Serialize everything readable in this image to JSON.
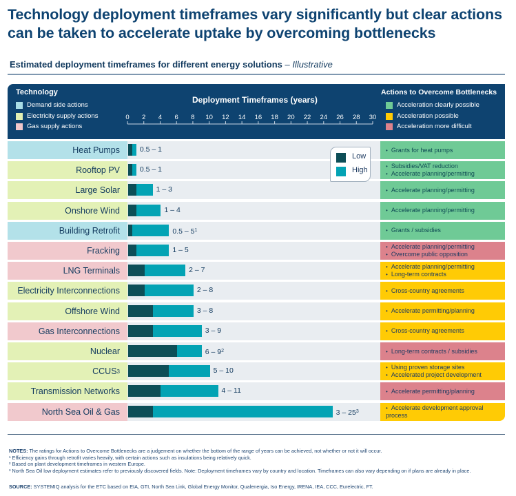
{
  "title": "Technology deployment timeframes vary significantly but clear actions can be taken to accelerate uptake by overcoming bottlenecks",
  "subtitle": "Estimated deployment timeframes for different energy solutions",
  "subtitle_suffix": " – Illustrative",
  "header": {
    "technology_heading": "Technology",
    "technology_legend": [
      {
        "label": "Demand side actions",
        "color": "#a8dde6"
      },
      {
        "label": "Electricity supply actions",
        "color": "#e2f0b3"
      },
      {
        "label": "Gas supply actions",
        "color": "#f0c7cb"
      }
    ],
    "deployment_heading": "Deployment Timeframes (years)",
    "actions_heading": "Actions to Overcome Bottlenecks",
    "actions_legend": [
      {
        "label": "Acceleration clearly possible",
        "color": "#6fca96"
      },
      {
        "label": "Acceleration possible",
        "color": "#ffcb05"
      },
      {
        "label": "Acceleration more difficult",
        "color": "#dc828c"
      }
    ]
  },
  "bar_legend": {
    "low_label": "Low",
    "high_label": "High",
    "low_color": "#0d4e57",
    "high_color": "#03a3b4"
  },
  "chart_data": {
    "type": "bar",
    "orientation": "horizontal-range",
    "title": "Estimated deployment timeframes for different energy solutions – Illustrative",
    "xlabel": "Deployment Timeframes (years)",
    "xlim": [
      0,
      30
    ],
    "xticks": [
      0,
      2,
      4,
      6,
      8,
      10,
      12,
      14,
      16,
      18,
      20,
      22,
      24,
      26,
      28,
      30
    ],
    "legend": [
      "Low",
      "High"
    ],
    "legend_position": "top-right",
    "categories": [
      "Heat Pumps",
      "Rooftop PV",
      "Large Solar",
      "Onshore Wind",
      "Building Retrofit",
      "Fracking",
      "LNG Terminals",
      "Electricity Interconnections",
      "Offshore Wind",
      "Gas Interconnections",
      "Nuclear",
      "CCUS",
      "Transmission Networks",
      "North Sea Oil & Gas"
    ],
    "rows": [
      {
        "label": "Heat Pumps",
        "sup": "",
        "group": "demand",
        "low": 0.5,
        "high": 1,
        "value_label": "0.5 – 1",
        "value_sup": "",
        "rating": "green",
        "actions": [
          "Grants for heat pumps"
        ]
      },
      {
        "label": "Rooftop PV",
        "sup": "",
        "group": "electricity",
        "low": 0.5,
        "high": 1,
        "value_label": "0.5 – 1",
        "value_sup": "",
        "rating": "green",
        "actions": [
          "Subsidies/VAT reduction",
          "Accelerate planning/permitting"
        ]
      },
      {
        "label": "Large Solar",
        "sup": "",
        "group": "electricity",
        "low": 1,
        "high": 3,
        "value_label": "1 – 3",
        "value_sup": "",
        "rating": "green",
        "actions": [
          "Accelerate planning/permitting"
        ]
      },
      {
        "label": "Onshore Wind",
        "sup": "",
        "group": "electricity",
        "low": 1,
        "high": 4,
        "value_label": "1 – 4",
        "value_sup": "",
        "rating": "green",
        "actions": [
          "Accelerate planning/permitting"
        ]
      },
      {
        "label": "Building Retrofit",
        "sup": "",
        "group": "demand",
        "low": 0.5,
        "high": 5,
        "value_label": "0.5 – 5",
        "value_sup": "1",
        "rating": "green",
        "actions": [
          "Grants / subsidies"
        ]
      },
      {
        "label": "Fracking",
        "sup": "",
        "group": "gas",
        "low": 1,
        "high": 5,
        "value_label": "1 – 5",
        "value_sup": "",
        "rating": "red",
        "actions": [
          "Accelerate planning/permitting",
          "Overcome public opposition"
        ]
      },
      {
        "label": "LNG Terminals",
        "sup": "",
        "group": "gas",
        "low": 2,
        "high": 7,
        "value_label": "2 – 7",
        "value_sup": "",
        "rating": "yellow",
        "actions": [
          "Accelerate planning/permitting",
          "Long-term contracts"
        ]
      },
      {
        "label": "Electricity Interconnections",
        "sup": "",
        "group": "electricity",
        "low": 2,
        "high": 8,
        "value_label": "2 – 8",
        "value_sup": "",
        "rating": "yellow",
        "actions": [
          "Cross-country agreements"
        ]
      },
      {
        "label": "Offshore Wind",
        "sup": "",
        "group": "electricity",
        "low": 3,
        "high": 8,
        "value_label": "3 – 8",
        "value_sup": "",
        "rating": "yellow",
        "actions": [
          "Accelerate permitting/planning"
        ]
      },
      {
        "label": "Gas Interconnections",
        "sup": "",
        "group": "gas",
        "low": 3,
        "high": 9,
        "value_label": "3 – 9",
        "value_sup": "",
        "rating": "yellow",
        "actions": [
          "Cross-country agreements"
        ]
      },
      {
        "label": "Nuclear",
        "sup": "",
        "group": "electricity",
        "low": 6,
        "high": 9,
        "value_label": "6 – 9",
        "value_sup": "2",
        "rating": "red",
        "actions": [
          "Long-term contracts / subsidies"
        ]
      },
      {
        "label": "CCUS",
        "sup": "3",
        "group": "electricity",
        "low": 5,
        "high": 10,
        "value_label": "5 – 10",
        "value_sup": "",
        "rating": "yellow",
        "actions": [
          "Using proven storage sites",
          "Accelerated project development"
        ]
      },
      {
        "label": "Transmission Networks",
        "sup": "",
        "group": "electricity",
        "low": 4,
        "high": 11,
        "value_label": "4 – 11",
        "value_sup": "",
        "rating": "red",
        "actions": [
          "Accelerate permitting/planning"
        ]
      },
      {
        "label": "North Sea Oil & Gas",
        "sup": "",
        "group": "gas",
        "low": 3,
        "high": 25,
        "value_label": "3 – 25",
        "value_sup": "3",
        "rating": "yellow",
        "actions": [
          "Accelerate development approval process"
        ]
      }
    ]
  },
  "colors": {
    "groups": {
      "demand": "#b3e1e9",
      "electricity": "#e3f1b6",
      "gas": "#f1c9cd"
    },
    "ratings": {
      "green": "#6fca96",
      "yellow": "#ffcb05",
      "red": "#dc828c"
    }
  },
  "notes": {
    "notes_label": "NOTES:",
    "notes_text": " The ratings for Actions to Overcome Bottlenecks are a judgement on whether the bottom of the range of years can be achieved, not whether or not it will occur.",
    "footnote_1": "¹ Efficiency gains through retrofit varies heavily, with certain actions such as insulations being relatively quick.",
    "footnote_2": "² Based on plant development timeframes in western Europe.",
    "footnote_3": "³ North Sea Oil low deployment estimates refer to previously discovered fields. Note: Deployment timeframes vary by country and location. Timeframes can also vary depending on if plans are already in place.",
    "source_label": "SOURCE:",
    "source_text": " SYSTEMIQ analysis for the ETC based on EIA, GTI, North Sea Link, Global Energy Monitor, Qualenergia, Iso Energy, IRENA, IEA, CCC, Eurelectric, FT."
  }
}
